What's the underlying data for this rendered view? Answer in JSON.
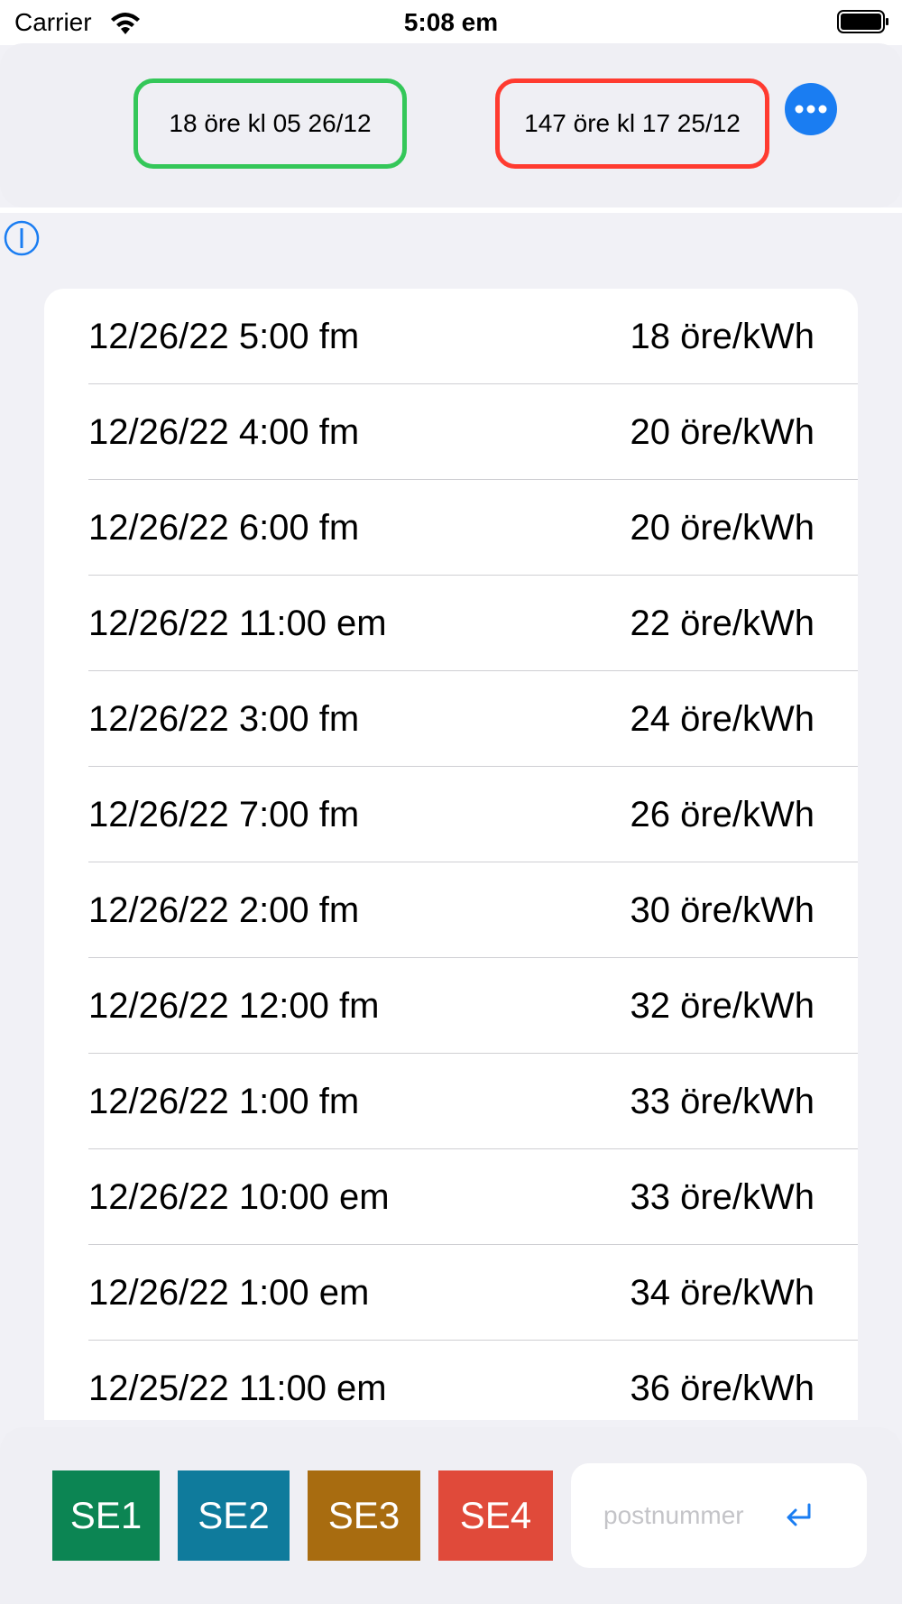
{
  "status_bar": {
    "carrier": "Carrier",
    "time": "5:08 em"
  },
  "header": {
    "lowest_price": "18 öre kl 05 26/12",
    "highest_price": "147 öre kl 17 25/12",
    "more_icon": "ellipsis-circle-icon"
  },
  "info_icon": "info-circle-icon",
  "prices": [
    {
      "time": "12/26/22 5:00 fm",
      "price": "18 öre/kWh"
    },
    {
      "time": "12/26/22 4:00 fm",
      "price": "20 öre/kWh"
    },
    {
      "time": "12/26/22 6:00 fm",
      "price": "20 öre/kWh"
    },
    {
      "time": "12/26/22 11:00 em",
      "price": "22 öre/kWh"
    },
    {
      "time": "12/26/22 3:00 fm",
      "price": "24 öre/kWh"
    },
    {
      "time": "12/26/22 7:00 fm",
      "price": "26 öre/kWh"
    },
    {
      "time": "12/26/22 2:00 fm",
      "price": "30 öre/kWh"
    },
    {
      "time": "12/26/22 12:00 fm",
      "price": "32 öre/kWh"
    },
    {
      "time": "12/26/22 1:00 fm",
      "price": "33 öre/kWh"
    },
    {
      "time": "12/26/22 10:00 em",
      "price": "33 öre/kWh"
    },
    {
      "time": "12/26/22 1:00 em",
      "price": "34 öre/kWh"
    },
    {
      "time": "12/25/22 11:00 em",
      "price": "36 öre/kWh"
    }
  ],
  "regions": [
    {
      "label": "SE1",
      "color": "#0c8553"
    },
    {
      "label": "SE2",
      "color": "#0f7b9c"
    },
    {
      "label": "SE3",
      "color": "#a86c10"
    },
    {
      "label": "SE4",
      "color": "#e04a3a"
    }
  ],
  "postal": {
    "placeholder": "postnummer",
    "value": "",
    "return_icon": "return-arrow-icon"
  },
  "colors": {
    "low_border": "#34c759",
    "high_border": "#ff3b30",
    "accent": "#1a7df2"
  }
}
